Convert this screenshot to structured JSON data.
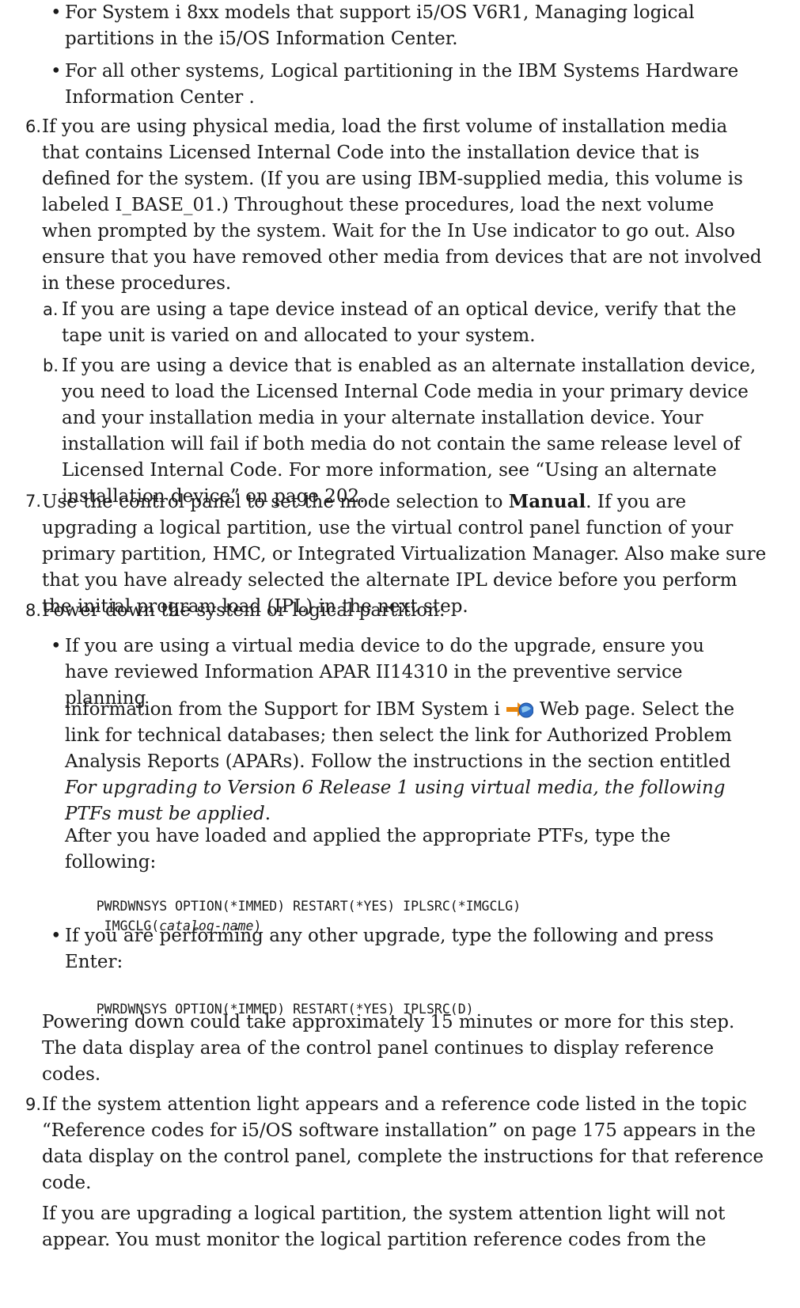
{
  "bullets_top": [
    "For System i 8xx models that support i5/OS V6R1, Managing logical partitions in the i5/OS Information Center.",
    "For all other systems, Logical partitioning in the IBM Systems Hardware Information Center ."
  ],
  "step6": {
    "num": "6.",
    "text": "If you are using physical media, load the first volume of installation media that contains Licensed Internal Code into the installation device that is defined for the system. (If you are using IBM-supplied media, this volume is labeled I_BASE_01.) Throughout these procedures, load the next volume when prompted by the system. Wait for the In Use indicator to go out. Also ensure that you have removed other media from devices that are not involved in these procedures.",
    "a_marker": "a.",
    "a_text": "If you are using a tape device instead of an optical device, verify that the tape unit is varied on and allocated to your system.",
    "b_marker": "b.",
    "b_text": "If you are using a device that is enabled as an alternate installation device, you need to load the Licensed Internal Code media in your primary device and your installation media in your alternate installation device. Your installation will fail if both media do not contain the same release level of Licensed Internal Code. For more information, see “Using an alternate installation device” on page 202."
  },
  "step7": {
    "num": "7.",
    "text_before": "Use the control panel to set the mode selection to ",
    "bold": "Manual",
    "text_after": ". If you are upgrading a logical partition, use the virtual control panel function of your primary partition, HMC, or Integrated Virtualization Manager. Also make sure that you have already selected the alternate IPL device before you perform the initial program load (IPL) in the next step."
  },
  "step8": {
    "num": "8.",
    "text": "Power down the system or logical partition:",
    "bullet1_a": "If you are using a virtual media device to do the upgrade, ensure you have reviewed Information APAR II14310 in the preventive service planning",
    "bullet1_b": "information from the Support for IBM System i",
    "bullet1_c": "Web page. Select the link for technical databases; then select the link for Authorized Problem Analysis Reports (APARs). Follow the instructions in the section entitled",
    "bullet1_italic": "For upgrading to Version 6 Release 1 using virtual media, the following PTFs must be applied",
    "bullet1_end": ".",
    "after_ptf": "After you have loaded and applied the appropriate PTFs, type the following:",
    "cmd1_line1": "PWRDWNSYS OPTION(*IMMED) RESTART(*YES) IPLSRC(*IMGCLG)",
    "cmd1_line2_a": " IMGCLG(",
    "cmd1_line2_it": "catalog-name",
    "cmd1_line2_b": ")",
    "bullet2": "If you are performing any other upgrade, type the following and press Enter:",
    "cmd2": "PWRDWNSYS OPTION(*IMMED) RESTART(*YES) IPLSRC(D)",
    "powering": "Powering down could take approximately 15 minutes or more for this step. The data display area of the control panel continues to display reference codes."
  },
  "step9": {
    "num": "9.",
    "text": "If the system attention light appears and a reference code listed in the topic “Reference codes for i5/OS software installation” on page 175 appears in the data display on the control panel, complete the instructions for that reference code.",
    "para2": "If you are upgrading a logical partition, the system attention light will not appear. You must monitor the logical partition reference codes from the"
  }
}
